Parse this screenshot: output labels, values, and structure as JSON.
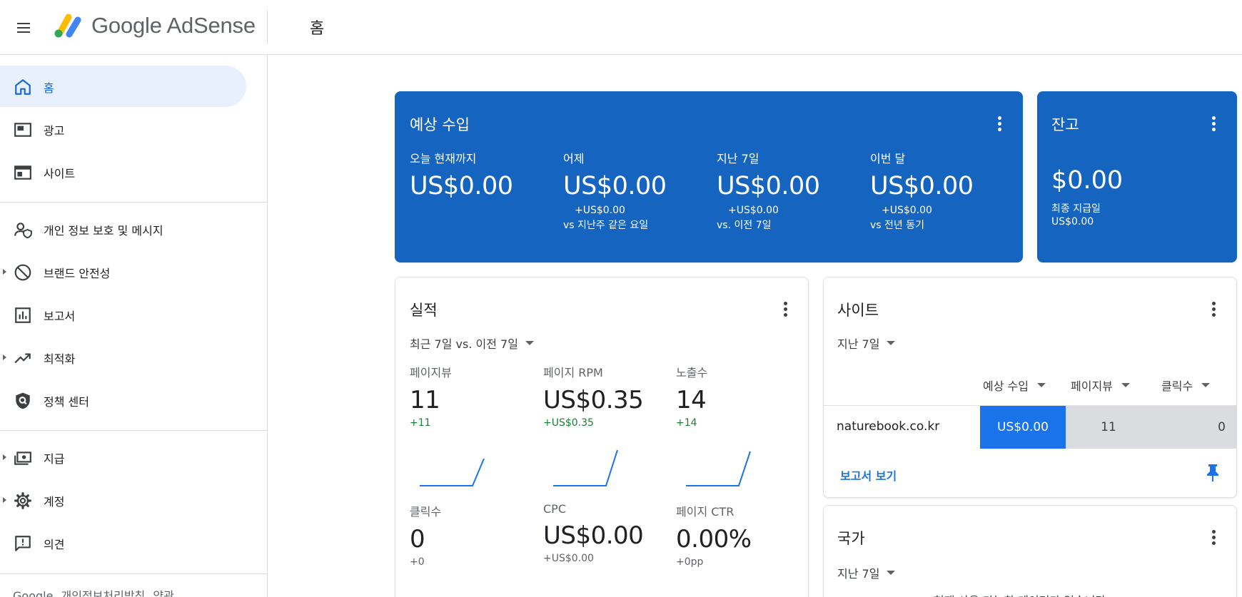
{
  "header": {
    "brand": "Google AdSense",
    "page_title": "홈"
  },
  "sidebar": {
    "items": [
      {
        "label": "홈",
        "icon": "home-icon",
        "active": true
      },
      {
        "label": "광고",
        "icon": "ads-icon"
      },
      {
        "label": "사이트",
        "icon": "sites-icon"
      },
      {
        "label": "개인 정보 보호 및 메시지",
        "icon": "privacy-messaging-icon"
      },
      {
        "label": "브랜드 안전성",
        "icon": "block-icon"
      },
      {
        "label": "보고서",
        "icon": "reports-icon"
      },
      {
        "label": "최적화",
        "icon": "trending-up-icon"
      },
      {
        "label": "정책 센터",
        "icon": "policy-shield-icon"
      },
      {
        "label": "지급",
        "icon": "payments-icon"
      },
      {
        "label": "계정",
        "icon": "gear-icon"
      },
      {
        "label": "의견",
        "icon": "feedback-icon"
      }
    ],
    "footer": [
      "Google",
      "개인정보처리방침",
      "약관"
    ]
  },
  "estimated_earnings": {
    "title": "예상 수입",
    "metrics": [
      {
        "label": "오늘 현재까지",
        "value": "US$0.00",
        "delta": "",
        "sub": ""
      },
      {
        "label": "어제",
        "value": "US$0.00",
        "delta": "+US$0.00",
        "sub": "vs 지난주 같은 요일"
      },
      {
        "label": "지난 7일",
        "value": "US$0.00",
        "delta": "+US$0.00",
        "sub": "vs. 이전 7일"
      },
      {
        "label": "이번 달",
        "value": "US$0.00",
        "delta": "+US$0.00",
        "sub": "vs 전년 동기"
      }
    ]
  },
  "balance": {
    "title": "잔고",
    "value": "$0.00",
    "last_payment_label": "최종 지급일",
    "last_payment_value": "US$0.00"
  },
  "performance": {
    "title": "실적",
    "range": "최근 7일 vs. 이전 7일",
    "metrics": [
      {
        "label": "페이지뷰",
        "value": "11",
        "delta": "+11"
      },
      {
        "label": "페이지 RPM",
        "value": "US$0.35",
        "delta": "+US$0.35"
      },
      {
        "label": "노출수",
        "value": "14",
        "delta": "+14"
      },
      {
        "label": "클릭수",
        "value": "0",
        "delta": "+0"
      },
      {
        "label": "CPC",
        "value": "US$0.00",
        "delta": "+US$0.00"
      },
      {
        "label": "페이지 CTR",
        "value": "0.00%",
        "delta": "+0pp"
      }
    ]
  },
  "sites": {
    "title": "사이트",
    "range": "지난 7일",
    "columns": [
      "예상 수입",
      "페이지뷰",
      "클릭수"
    ],
    "rows": [
      {
        "site": "naturebook.co.kr",
        "revenue": "US$0.00",
        "pageviews": "11",
        "clicks": "0"
      }
    ],
    "report_link": "보고서 보기"
  },
  "countries": {
    "title": "국가",
    "range": "지난 7일",
    "empty_text": "현재 사용 가능한 데이터가 없습니다"
  },
  "colors": {
    "primary_blue": "#1565c0",
    "accent_blue": "#1a73e8",
    "positive_green": "#188038",
    "active_nav_bg": "#e8f0fe"
  }
}
